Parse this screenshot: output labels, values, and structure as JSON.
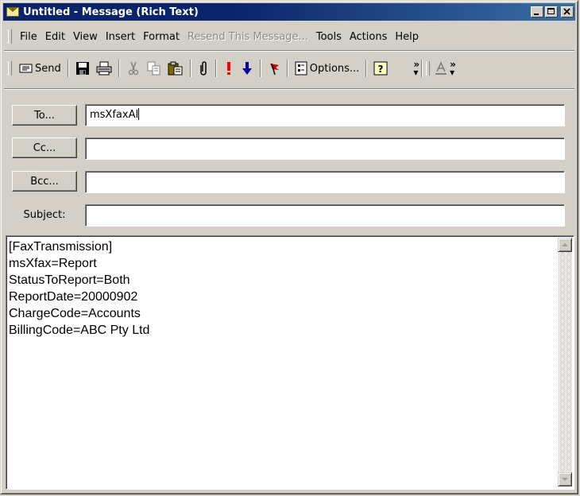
{
  "window": {
    "title": "Untitled - Message (Rich Text)"
  },
  "menubar": {
    "items": [
      {
        "label": "File",
        "disabled": false
      },
      {
        "label": "Edit",
        "disabled": false
      },
      {
        "label": "View",
        "disabled": false
      },
      {
        "label": "Insert",
        "disabled": false
      },
      {
        "label": "Format",
        "disabled": false
      },
      {
        "label": "Resend This Message...",
        "disabled": true
      },
      {
        "label": "Tools",
        "disabled": false
      },
      {
        "label": "Actions",
        "disabled": false
      },
      {
        "label": "Help",
        "disabled": false
      }
    ]
  },
  "toolbar": {
    "send_label": "Send",
    "options_label": "Options...",
    "icons": [
      "send-icon",
      "save-icon",
      "print-icon",
      "cut-icon",
      "copy-icon",
      "paste-icon",
      "attach-icon",
      "importance-high-icon",
      "importance-low-icon",
      "flag-icon",
      "options-icon",
      "help-icon",
      "more-chevron-icon",
      "font-color-icon"
    ]
  },
  "header": {
    "to_button": "To...",
    "cc_button": "Cc...",
    "bcc_button": "Bcc...",
    "subject_label": "Subject:",
    "to_value": "msXfaxAI",
    "cc_value": "",
    "bcc_value": "",
    "subject_value": ""
  },
  "body": {
    "lines": [
      "[FaxTransmission]",
      "msXfax=Report",
      "StatusToReport=Both",
      "ReportDate=20000902",
      "ChargeCode=Accounts",
      "BillingCode=ABC Pty Ltd"
    ]
  },
  "colors": {
    "titlebar": "#0a246a",
    "face": "#d4d0c8",
    "importance_high": "#ff0000",
    "importance_low": "#0000a0"
  }
}
